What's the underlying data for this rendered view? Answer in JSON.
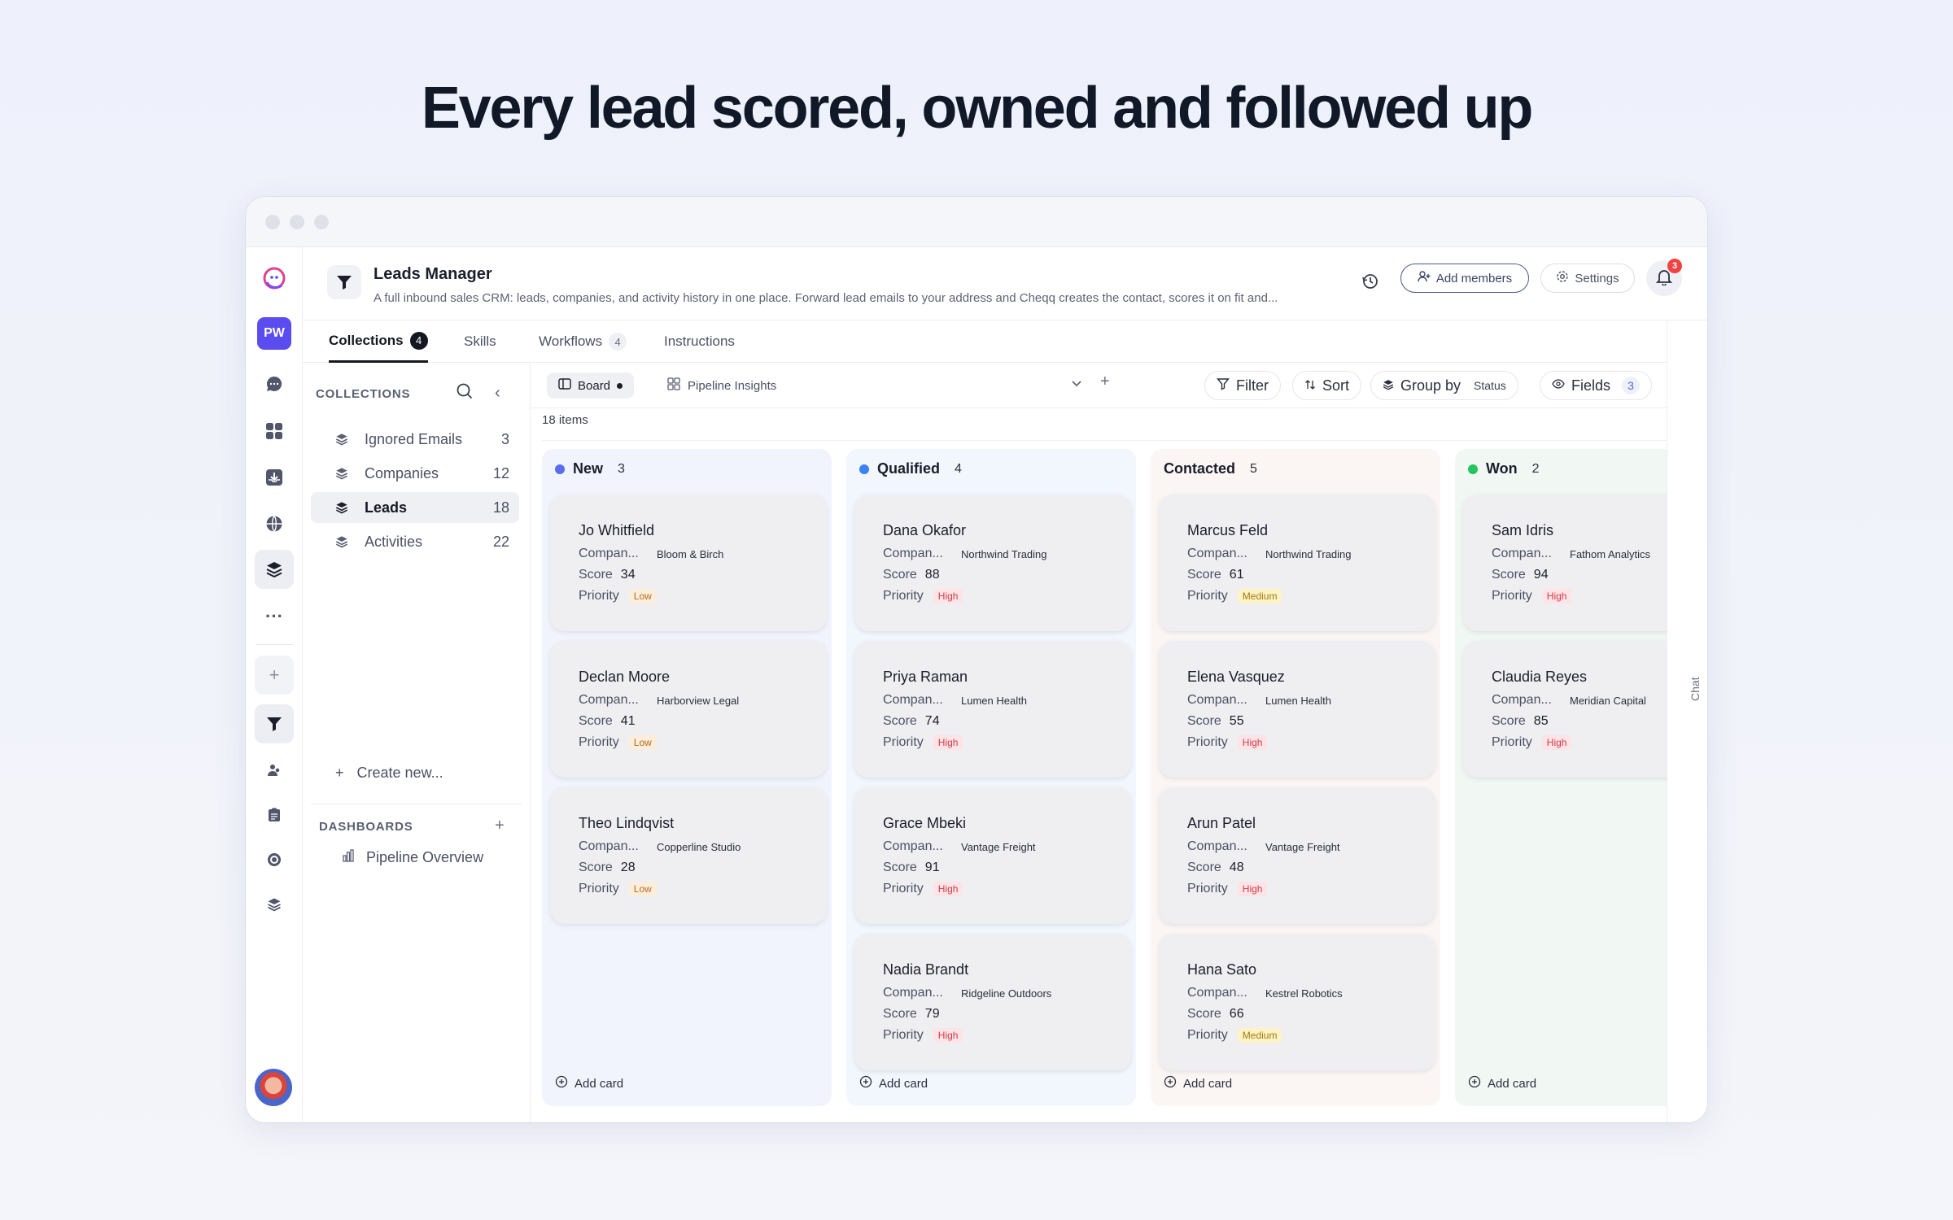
{
  "hero": {
    "title": "Every lead scored, owned and followed up"
  },
  "rail": {
    "workspace_initials": "PW",
    "icons": [
      "brand-logo-icon",
      "chat-icon",
      "apps-icon",
      "inbox-icon",
      "globe-icon",
      "layers-icon",
      "more-icon",
      "add-icon",
      "funnel-icon",
      "people-icon",
      "clipboard-icon",
      "target-icon",
      "stack-icon"
    ]
  },
  "header": {
    "title": "Leads Manager",
    "description": "A full inbound sales CRM: leads, companies, and activity history in one place. Forward lead emails to your address and Cheqq creates the contact, scores it on fit and...",
    "add_members": "Add members",
    "settings": "Settings",
    "notifications_count": "3"
  },
  "tabs": [
    {
      "label": "Collections",
      "count": "4"
    },
    {
      "label": "Skills",
      "count": ""
    },
    {
      "label": "Workflows",
      "count": "4"
    },
    {
      "label": "Instructions",
      "count": ""
    }
  ],
  "collections": {
    "heading": "COLLECTIONS",
    "items": [
      {
        "label": "Ignored Emails",
        "count": "3"
      },
      {
        "label": "Companies",
        "count": "12"
      },
      {
        "label": "Leads",
        "count": "18"
      },
      {
        "label": "Activities",
        "count": "22"
      }
    ],
    "create_new": "Create new...",
    "dashboards_heading": "DASHBOARDS",
    "dashboards": [
      {
        "label": "Pipeline Overview"
      }
    ]
  },
  "toolbar": {
    "board": "Board",
    "insights": "Pipeline Insights",
    "filter": "Filter",
    "sort": "Sort",
    "group_by": "Group by",
    "group_by_value": "Status",
    "fields": "Fields",
    "fields_count": "3",
    "items_count": "18 items"
  },
  "board": {
    "add_card": "Add card",
    "field_company": "Compan...",
    "field_score": "Score",
    "field_priority": "Priority",
    "columns": [
      {
        "name": "New",
        "count": "3",
        "color": "#5b6cf0",
        "bg": "#f2f4fd",
        "cards": [
          {
            "name": "Jo Whitfield",
            "company": "Bloom & Birch",
            "score": "34",
            "priority": "Low"
          },
          {
            "name": "Declan Moore",
            "company": "Harborview Legal",
            "score": "41",
            "priority": "Low"
          },
          {
            "name": "Theo Lindqvist",
            "company": "Copperline Studio",
            "score": "28",
            "priority": "Low"
          }
        ]
      },
      {
        "name": "Qualified",
        "count": "4",
        "color": "#3b82f6",
        "bg": "#f2f6fd",
        "cards": [
          {
            "name": "Dana Okafor",
            "company": "Northwind Trading",
            "score": "88",
            "priority": "High"
          },
          {
            "name": "Priya Raman",
            "company": "Lumen Health",
            "score": "74",
            "priority": "High"
          },
          {
            "name": "Grace Mbeki",
            "company": "Vantage Freight",
            "score": "91",
            "priority": "High"
          },
          {
            "name": "Nadia Brandt",
            "company": "Ridgeline Outdoors",
            "score": "79",
            "priority": "High"
          }
        ]
      },
      {
        "name": "Contacted",
        "count": "5",
        "color": "",
        "bg": "#fbf6f4",
        "cards": [
          {
            "name": "Marcus Feld",
            "company": "Northwind Trading",
            "score": "61",
            "priority": "Medium"
          },
          {
            "name": "Elena Vasquez",
            "company": "Lumen Health",
            "score": "55",
            "priority": "High"
          },
          {
            "name": "Arun Patel",
            "company": "Vantage Freight",
            "score": "48",
            "priority": "High"
          },
          {
            "name": "Hana Sato",
            "company": "Kestrel Robotics",
            "score": "66",
            "priority": "Medium"
          }
        ]
      },
      {
        "name": "Won",
        "count": "2",
        "color": "#22c55e",
        "bg": "#f1f8f4",
        "cards": [
          {
            "name": "Sam Idris",
            "company": "Fathom Analytics",
            "score": "94",
            "priority": "High"
          },
          {
            "name": "Claudia Reyes",
            "company": "Meridian Capital",
            "score": "85",
            "priority": "High"
          }
        ]
      }
    ]
  },
  "chat": {
    "label": "Chat"
  }
}
